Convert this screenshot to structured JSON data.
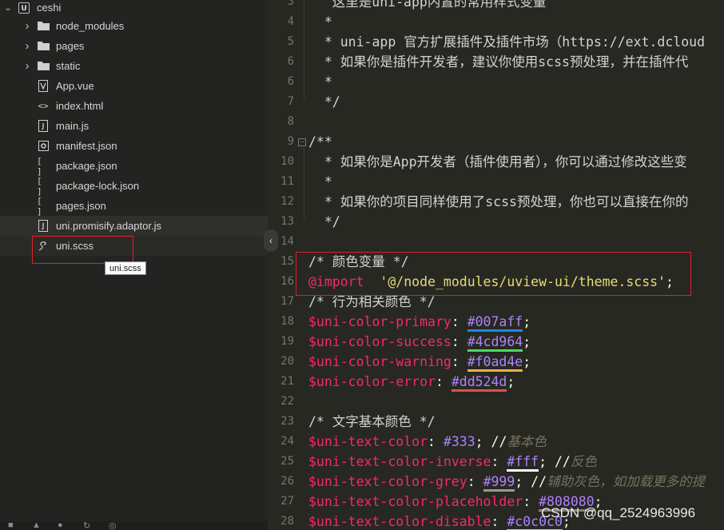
{
  "explorer": {
    "project": "ceshi",
    "items": [
      {
        "label": "node_modules",
        "icon": "folder-icon",
        "expandable": true
      },
      {
        "label": "pages",
        "icon": "folder-icon",
        "expandable": true
      },
      {
        "label": "static",
        "icon": "folder-icon",
        "expandable": true
      },
      {
        "label": "App.vue",
        "icon": "vue-file-icon"
      },
      {
        "label": "index.html",
        "icon": "html-file-icon",
        "glyph": "<>"
      },
      {
        "label": "main.js",
        "icon": "js-file-icon"
      },
      {
        "label": "manifest.json",
        "icon": "manifest-file-icon"
      },
      {
        "label": "package.json",
        "icon": "json-file-icon",
        "glyph": "[ ]"
      },
      {
        "label": "package-lock.json",
        "icon": "json-file-icon",
        "glyph": "[ ]"
      },
      {
        "label": "pages.json",
        "icon": "json-file-icon",
        "glyph": "[ ]"
      },
      {
        "label": "uni.promisify.adaptor.js",
        "icon": "js-file-icon"
      },
      {
        "label": "uni.scss",
        "icon": "scss-file-icon"
      }
    ],
    "tooltip": "uni.scss"
  },
  "editor": {
    "lines": [
      {
        "n": "3",
        "parts": [
          [
            "c-comment",
            "   这里是uni-app内置的常用样式变量"
          ]
        ]
      },
      {
        "n": "4",
        "parts": [
          [
            "c-comment",
            "  *"
          ]
        ]
      },
      {
        "n": "5",
        "parts": [
          [
            "c-comment",
            "  * uni-app 官方扩展插件及插件市场（https://ext.dcloud"
          ]
        ]
      },
      {
        "n": "6",
        "parts": [
          [
            "c-comment",
            "  * 如果你是插件开发者，建议你使用scss预处理，并在插件代"
          ]
        ]
      },
      {
        "n": "6b",
        "label": "6",
        "parts": [
          [
            "c-comment",
            "  *"
          ]
        ]
      },
      {
        "n": "7",
        "parts": [
          [
            "c-comment",
            "  */"
          ]
        ]
      },
      {
        "n": "8",
        "parts": []
      },
      {
        "n": "9",
        "parts": [
          [
            "c-comment",
            "/**"
          ]
        ],
        "fold": true
      },
      {
        "n": "10",
        "parts": [
          [
            "c-comment",
            "  * 如果你是App开发者（插件使用者），你可以通过修改这些变"
          ]
        ]
      },
      {
        "n": "11",
        "parts": [
          [
            "c-comment",
            "  *"
          ]
        ]
      },
      {
        "n": "12",
        "parts": [
          [
            "c-comment",
            "  * 如果你的项目同样使用了scss预处理，你也可以直接在你的"
          ]
        ]
      },
      {
        "n": "13",
        "parts": [
          [
            "c-comment",
            "  */"
          ]
        ]
      },
      {
        "n": "14",
        "parts": []
      },
      {
        "n": "15",
        "parts": [
          [
            "c-comment",
            "/* 颜色变量 */"
          ]
        ]
      },
      {
        "n": "16",
        "parts": [
          [
            "c-at",
            "@import"
          ],
          [
            "",
            "  "
          ],
          [
            "c-str",
            "'@/node_modules/uview-ui/theme.scss'"
          ],
          [
            "",
            ";"
          ]
        ]
      },
      {
        "n": "17",
        "parts": [
          [
            "c-comment",
            "/* 行为相关颜色 */"
          ]
        ]
      },
      {
        "n": "18",
        "parts": [
          [
            "c-var",
            "$uni-color-primary"
          ],
          [
            "",
            ": "
          ],
          [
            "sw:#1e88e5",
            "#007aff"
          ],
          [
            "",
            ";"
          ]
        ]
      },
      {
        "n": "19",
        "parts": [
          [
            "c-var",
            "$uni-color-success"
          ],
          [
            "",
            ": "
          ],
          [
            "sw:#4cd964",
            "#4cd964"
          ],
          [
            "",
            ";"
          ]
        ]
      },
      {
        "n": "20",
        "parts": [
          [
            "c-var",
            "$uni-color-warning"
          ],
          [
            "",
            ": "
          ],
          [
            "sw:#f0ad4e",
            "#f0ad4e"
          ],
          [
            "",
            ";"
          ]
        ]
      },
      {
        "n": "21",
        "parts": [
          [
            "c-var",
            "$uni-color-error"
          ],
          [
            "",
            ": "
          ],
          [
            "sw:#dd524d",
            "#dd524d"
          ],
          [
            "",
            ";"
          ]
        ]
      },
      {
        "n": "22",
        "parts": []
      },
      {
        "n": "23",
        "parts": [
          [
            "c-comment",
            "/* 文字基本颜色 */"
          ]
        ]
      },
      {
        "n": "24",
        "parts": [
          [
            "c-var",
            "$uni-text-color"
          ],
          [
            "",
            ": "
          ],
          [
            "c-num",
            "#333"
          ],
          [
            "",
            "; //"
          ],
          [
            "c-italic",
            "基本色"
          ]
        ]
      },
      {
        "n": "25",
        "parts": [
          [
            "c-var",
            "$uni-text-color-inverse"
          ],
          [
            "",
            ": "
          ],
          [
            "sw:#ffffff",
            "#fff"
          ],
          [
            "",
            "; //"
          ],
          [
            "c-italic",
            "反色"
          ]
        ]
      },
      {
        "n": "26",
        "parts": [
          [
            "c-var",
            "$uni-text-color-grey"
          ],
          [
            "",
            ": "
          ],
          [
            "sw:#999999",
            "#999"
          ],
          [
            "",
            "; //"
          ],
          [
            "c-italic",
            "辅助灰色，如加载更多的提"
          ]
        ]
      },
      {
        "n": "27",
        "parts": [
          [
            "c-var",
            "$uni-text-color-placeholder"
          ],
          [
            "",
            ": "
          ],
          [
            "sw:#808080",
            "#808080"
          ],
          [
            "",
            ";"
          ]
        ]
      },
      {
        "n": "28",
        "parts": [
          [
            "c-var",
            "$uni-text-color-disable"
          ],
          [
            "",
            ": "
          ],
          [
            "sw:#c0c0c0",
            "#c0c0c0"
          ],
          [
            "",
            ";"
          ]
        ]
      }
    ]
  },
  "watermark": "CSDN @qq_2524963996",
  "colors": {
    "highlight_border": "#e0202a",
    "editor_bg": "#272822",
    "sidebar_bg": "#232421"
  }
}
